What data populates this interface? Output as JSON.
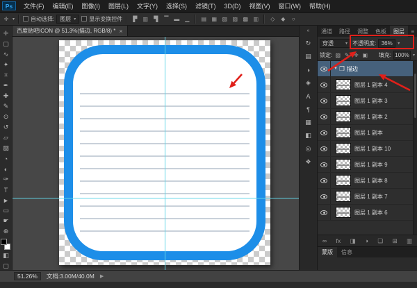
{
  "app": {
    "logo_text": "Ps"
  },
  "glyphs": {
    "caret": "▾"
  },
  "menubar": {
    "items": [
      "文件(F)",
      "编辑(E)",
      "图像(I)",
      "图层(L)",
      "文字(Y)",
      "选择(S)",
      "滤镜(T)",
      "3D(D)",
      "视图(V)",
      "窗口(W)",
      "帮助(H)"
    ]
  },
  "optionsbar": {
    "tool_glyph": "✛",
    "auto_select_label": "自动选择:",
    "auto_select_value": "图层",
    "show_transform_label": "显示变换控件",
    "align_icons": [
      "▛",
      "▥",
      "▜",
      "▔",
      "▬",
      "▁"
    ],
    "distribute_icons": [
      "▤",
      "▦",
      "▧",
      "▨",
      "▩",
      "▥"
    ],
    "mode_icons": [
      "◇",
      "◆",
      "○"
    ]
  },
  "document": {
    "tab_title": "百度贴吧ICON @ 51.3%(描边, RGB/8) *",
    "close_glyph": "×"
  },
  "toolbar": {
    "tools": [
      {
        "name": "move-tool",
        "glyph": "✛"
      },
      {
        "name": "marquee-tool",
        "glyph": "▢"
      },
      {
        "name": "lasso-tool",
        "glyph": "∿"
      },
      {
        "name": "magic-wand-tool",
        "glyph": "✦"
      },
      {
        "name": "crop-tool",
        "glyph": "⌗"
      },
      {
        "name": "eyedropper-tool",
        "glyph": "✒"
      },
      {
        "name": "healing-brush-tool",
        "glyph": "✚"
      },
      {
        "name": "brush-tool",
        "glyph": "✎"
      },
      {
        "name": "clone-stamp-tool",
        "glyph": "⊙"
      },
      {
        "name": "history-brush-tool",
        "glyph": "↺"
      },
      {
        "name": "eraser-tool",
        "glyph": "▱"
      },
      {
        "name": "gradient-tool",
        "glyph": "▨"
      },
      {
        "name": "blur-tool",
        "glyph": "◔"
      },
      {
        "name": "dodge-tool",
        "glyph": "◐"
      },
      {
        "name": "pen-tool",
        "glyph": "✑"
      },
      {
        "name": "type-tool",
        "glyph": "T"
      },
      {
        "name": "path-select-tool",
        "glyph": "►"
      },
      {
        "name": "shape-tool",
        "glyph": "▭"
      },
      {
        "name": "hand-tool",
        "glyph": "☛"
      },
      {
        "name": "zoom-tool",
        "glyph": "⊕"
      }
    ],
    "quick_mask_glyph": "◧",
    "screen_mode_glyph": "▢"
  },
  "panel_strip": {
    "collapse_glyph": "«",
    "icons": [
      {
        "name": "history-panel-icon",
        "glyph": "↻"
      },
      {
        "name": "properties-panel-icon",
        "glyph": "▤"
      },
      {
        "name": "adjustments-panel-icon",
        "glyph": "◑"
      },
      {
        "name": "styles-panel-icon",
        "glyph": "◈"
      },
      {
        "name": "character-panel-icon",
        "glyph": "A"
      },
      {
        "name": "paragraph-panel-icon",
        "glyph": "¶"
      },
      {
        "name": "swatches-panel-icon",
        "glyph": "▦"
      },
      {
        "name": "color-panel-icon",
        "glyph": "◧"
      },
      {
        "name": "info-panel-icon",
        "glyph": "◎"
      },
      {
        "name": "navigator-panel-icon",
        "glyph": "❖"
      }
    ]
  },
  "layers_panel": {
    "tabs": [
      "通道",
      "路径",
      "调整",
      "色板",
      "图层"
    ],
    "panel_menu_glyph": "≡",
    "blend_mode": "穿透",
    "opacity_label": "不透明度:",
    "opacity_value": "36%",
    "lock_label": "锁定:",
    "lock_icons": [
      "▨",
      "✎",
      "✛",
      "▣"
    ],
    "fill_label": "填充:",
    "fill_value": "100%",
    "group": {
      "expander": "▼",
      "folder_glyph": "❐",
      "name": "描边"
    },
    "layers": [
      "图层 1 副本 4",
      "图层 1 副本 3",
      "图层 1 副本 2",
      "图层 1 副本",
      "图层 1 副本 10",
      "图层 1 副本 9",
      "图层 1 副本 8",
      "图层 1 副本 7",
      "图层 1 副本 6"
    ],
    "footer_icons": [
      {
        "name": "link-layers-icon",
        "glyph": "∞"
      },
      {
        "name": "layer-effects-icon",
        "glyph": "fx"
      },
      {
        "name": "add-mask-icon",
        "glyph": "◨"
      },
      {
        "name": "adjustment-layer-icon",
        "glyph": "◑"
      },
      {
        "name": "new-group-icon",
        "glyph": "❏"
      },
      {
        "name": "new-layer-icon",
        "glyph": "⊞"
      },
      {
        "name": "delete-layer-icon",
        "glyph": "▥"
      }
    ],
    "sub_tabs": [
      "蒙版",
      "信息"
    ]
  },
  "statusbar": {
    "zoom": "51.26%",
    "doc_info": "文档:3.00M/40.0M",
    "expand_glyph": "▶"
  },
  "colors": {
    "accent_blue": "#1d8ee8",
    "guide_cyan": "#63d6e8",
    "annotation_red": "#e0201a",
    "selected_layer_bg": "#46617c"
  }
}
